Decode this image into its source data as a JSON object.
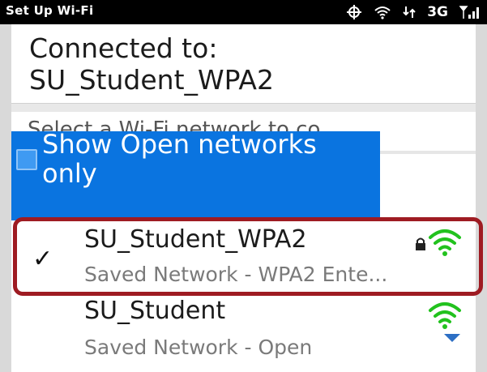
{
  "status_bar": {
    "title": "Set Up Wi-Fi",
    "network_type": "3G",
    "icons": [
      "gps-icon",
      "wifi-icon",
      "data-arrows-icon",
      "signal-bars-icon"
    ]
  },
  "connection": {
    "label": "Connected to:",
    "ssid": "SU_Student_WPA2"
  },
  "select_prompt": "Select a Wi-Fi network to co...",
  "filter": {
    "label": "Show Open networks only",
    "checked": false
  },
  "networks": [
    {
      "name": "SU_Student_WPA2",
      "status": "Saved Network - WPA2 Ente...",
      "connected": true,
      "check_glyph": "✓",
      "secured": true,
      "signal": "strong"
    },
    {
      "name": "SU_Student",
      "status": "Saved Network - Open",
      "connected": false,
      "secured": false,
      "signal": "strong"
    }
  ],
  "colors": {
    "selection_blue": "#0a74e0",
    "highlight_red": "#9e1b22",
    "wifi_green": "#22c21e",
    "status_bar": "#000000"
  }
}
